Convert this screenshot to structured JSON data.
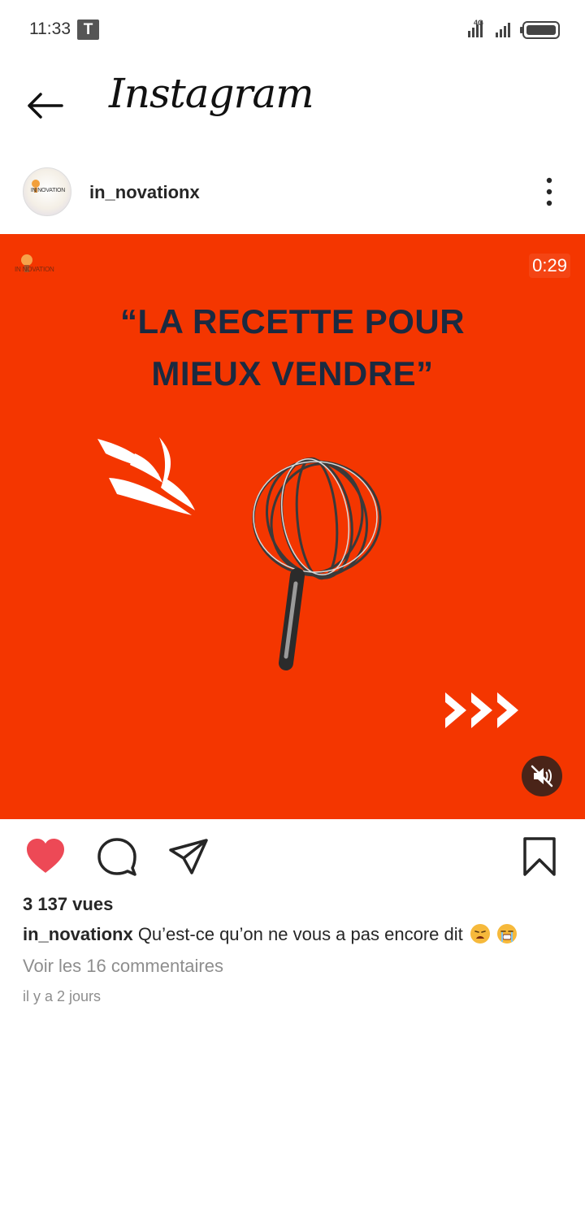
{
  "status_bar": {
    "time": "11:33",
    "notification_icon_letter": "T",
    "network_label": "4G"
  },
  "header": {
    "app_title": "Instagram"
  },
  "post": {
    "username": "in_novationx",
    "avatar_text": "IN NOVATION",
    "media": {
      "brand_text": "IN NOVATION",
      "duration": "0:29",
      "headline_line1": "“LA RECETTE POUR",
      "headline_line2": "MIEUX VENDRE”",
      "background_color": "#f43600",
      "headline_color": "#1b2a40"
    },
    "views": "3 137 vues",
    "caption_user": "in_novationx",
    "caption_text": "Qu’est-ce qu’on ne vous a pas encore dit",
    "comments_link": "Voir les 16 commentaires",
    "timestamp": "il y a 2 jours",
    "liked": true,
    "like_color": "#ed4956"
  }
}
